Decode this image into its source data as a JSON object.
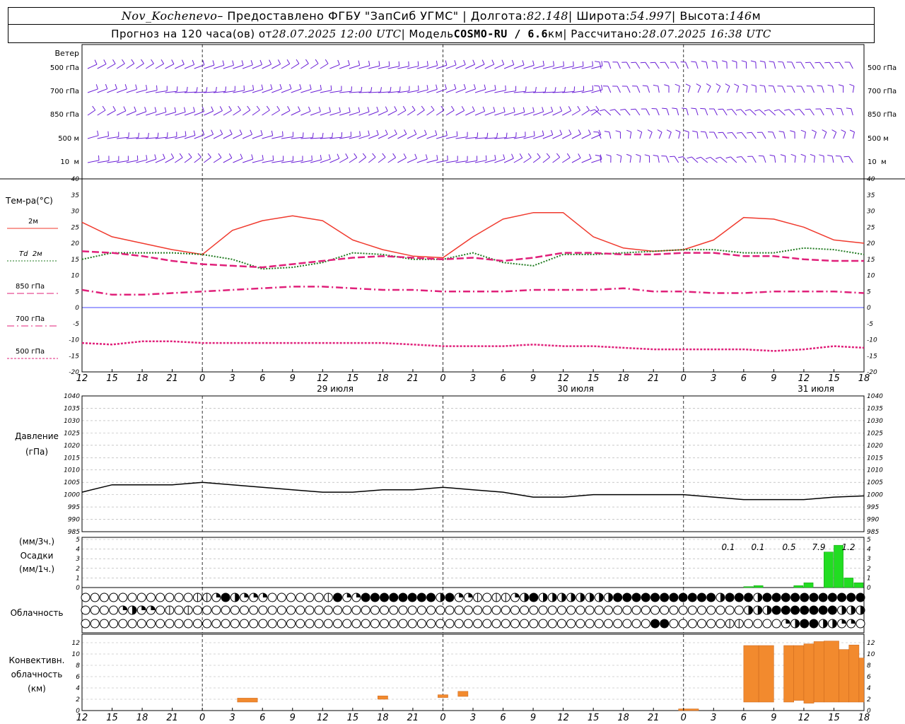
{
  "header": {
    "station": "Nov_Kochenevo",
    "provider": " – Предоставлено ФГБУ \"ЗапСиб УГМС\" | Долгота: ",
    "lon": "82.148",
    "lat_label": " | Широта: ",
    "lat": "54.997",
    "alt_label": " | Высота: ",
    "alt": "146",
    "alt_unit": "м",
    "forecast_label": "Прогноз на 120 часа(ов) от ",
    "forecast_start": "28.07.2025 12:00 UTC",
    "model_label": " | Модель ",
    "model": "COSMO-RU / 6.6",
    "model_unit": "км",
    "calc_label": " | Рассчитано: ",
    "calc_time": "28.07.2025 16:38 UTC"
  },
  "time_axis": {
    "hour_labels": [
      "12",
      "15",
      "18",
      "21",
      "0",
      "3",
      "6",
      "9",
      "12",
      "15",
      "18",
      "21",
      "0",
      "3",
      "6",
      "9",
      "12",
      "15",
      "18",
      "21",
      "0",
      "3",
      "6",
      "9",
      "12",
      "15",
      "18"
    ],
    "dates": [
      "29 июля",
      "30 июля",
      "31 июля"
    ]
  },
  "wind_panel": {
    "title": "Ветер",
    "levels": [
      "500 гПа",
      "700 гПа",
      "850 гПа",
      "500 м",
      "10  м"
    ],
    "barb_color": "#6a1fd6"
  },
  "temp_panel": {
    "title": "Тем-ра(°С)",
    "legend": [
      {
        "text": "2м",
        "color": "#f03a2e",
        "style": "solid"
      },
      {
        "text": "Td  2м",
        "color": "#1f7a1f",
        "style": "dotted"
      },
      {
        "text": "850 гПа",
        "color": "#e0207a",
        "style": "longdash"
      },
      {
        "text": "700 гПа",
        "color": "#e0207a",
        "style": "dashdot"
      },
      {
        "text": "500 гПа",
        "color": "#e0207a",
        "style": "shortdot"
      }
    ],
    "y_ticks": [
      "40",
      "35",
      "30",
      "25",
      "20",
      "15",
      "10",
      "5",
      "0",
      "-5",
      "-10",
      "-15",
      "-20"
    ]
  },
  "pressure_panel": {
    "title": "Давление",
    "unit": "(гПа)",
    "y_ticks": [
      "1040",
      "1035",
      "1030",
      "1025",
      "1020",
      "1015",
      "1010",
      "1005",
      "1000",
      "995",
      "990",
      "985"
    ]
  },
  "precip_panel": {
    "unit1": "(мм/3ч.)",
    "title": "Осадки",
    "unit2": "(мм/1ч.)",
    "y_ticks": [
      "5",
      "4",
      "3",
      "2",
      "1",
      "0"
    ],
    "totals": [
      "0.1",
      "0.1",
      "0.5",
      "7.9",
      "1.2"
    ]
  },
  "cloud_panel": {
    "title": "Облачность"
  },
  "conv_panel": {
    "title1": "Конвективн.",
    "title2": "облачность",
    "unit": "(км)",
    "y_ticks": [
      "12",
      "10",
      "8",
      "6",
      "4",
      "2",
      "0"
    ]
  },
  "chart_data": [
    {
      "type": "line",
      "title": "Тем-ра(°С)",
      "ylim": [
        -20,
        40
      ],
      "x_hours": [
        0,
        3,
        6,
        9,
        12,
        15,
        18,
        21,
        24,
        27,
        30,
        33,
        36,
        39,
        42,
        45,
        48,
        51,
        54,
        57,
        60,
        63,
        66,
        69,
        72,
        75,
        78
      ],
      "series": [
        {
          "name": "2м",
          "values": [
            26.5,
            22,
            20,
            18,
            16.5,
            24,
            27,
            28.5,
            27,
            21,
            18,
            16,
            15.5,
            22,
            27.5,
            29.5,
            29.5,
            22,
            18.5,
            17.5,
            18,
            21,
            28,
            27.5,
            25,
            21,
            20
          ]
        },
        {
          "name": "Td  2м",
          "values": [
            15,
            17,
            17,
            17,
            16.5,
            15,
            12,
            12.5,
            14,
            17,
            16.5,
            15,
            15,
            17,
            14,
            13,
            16.5,
            16.5,
            17,
            17.5,
            18,
            18,
            17,
            17,
            18.5,
            18,
            16.5
          ]
        },
        {
          "name": "850 гПа",
          "values": [
            17.5,
            17,
            16,
            14.5,
            13.5,
            13,
            12.5,
            13.5,
            14.5,
            15.5,
            16,
            15.5,
            15,
            15.5,
            14.5,
            15.5,
            17,
            17,
            16.5,
            16.5,
            17,
            17,
            16,
            16,
            15,
            14.5,
            14.5
          ]
        },
        {
          "name": "700 гПа",
          "values": [
            5.5,
            4,
            4,
            4.5,
            5,
            5.5,
            6,
            6.5,
            6.5,
            6,
            5.5,
            5.5,
            5,
            5,
            5,
            5.5,
            5.5,
            5.5,
            6,
            5,
            5,
            4.5,
            4.5,
            5,
            5,
            5,
            4.5
          ]
        },
        {
          "name": "500 гПа",
          "values": [
            -11,
            -11.5,
            -10.5,
            -10.5,
            -11,
            -11,
            -11,
            -11,
            -11,
            -11,
            -11,
            -11.5,
            -12,
            -12,
            -12,
            -11.5,
            -12,
            -12,
            -12.5,
            -13,
            -13,
            -13,
            -13,
            -13.5,
            -13,
            -12,
            -12.5
          ]
        }
      ]
    },
    {
      "type": "line",
      "title": "Давление",
      "ylim": [
        985,
        1040
      ],
      "x_hours": [
        0,
        3,
        6,
        9,
        12,
        15,
        18,
        21,
        24,
        27,
        30,
        33,
        36,
        39,
        42,
        45,
        48,
        51,
        54,
        57,
        60,
        63,
        66,
        69,
        72,
        75,
        78
      ],
      "series": [
        {
          "name": "",
          "values": [
            1001,
            1004,
            1004,
            1004,
            1005,
            1004,
            1003,
            1002,
            1001,
            1001,
            1002,
            1002,
            1003,
            1002,
            1001,
            999,
            999,
            1000,
            1000,
            1000,
            1000,
            999,
            998,
            998,
            998,
            999,
            999.5
          ]
        }
      ]
    },
    {
      "type": "bar",
      "title": "Осадки",
      "ylim": [
        0,
        5
      ],
      "x_hours": [
        66,
        67,
        68,
        69,
        70,
        71,
        72,
        73,
        74,
        75,
        76,
        77
      ],
      "values": [
        0.1,
        0.2,
        0,
        0,
        0,
        0.2,
        0.5,
        0,
        3.7,
        4.4,
        1,
        0.5
      ]
    },
    {
      "type": "bar",
      "title": "Конвективн. облачность",
      "ylim": [
        0,
        13
      ],
      "bars": [
        {
          "from": 15.5,
          "to": 17.5,
          "base": 1.5,
          "top": 2.2
        },
        {
          "from": 29.5,
          "to": 30.5,
          "base": 2,
          "top": 2.6
        },
        {
          "from": 35.5,
          "to": 36.5,
          "base": 2.3,
          "top": 2.8
        },
        {
          "from": 37.5,
          "to": 38.5,
          "base": 2.5,
          "top": 3.4
        },
        {
          "from": 59.5,
          "to": 61.5,
          "base": 0,
          "top": 0.3
        },
        {
          "from": 66,
          "to": 67.5,
          "base": 1.5,
          "top": 11.5
        },
        {
          "from": 67.5,
          "to": 69,
          "base": 1.5,
          "top": 11.5
        },
        {
          "from": 70,
          "to": 71,
          "base": 1.5,
          "top": 11.5
        },
        {
          "from": 71,
          "to": 72,
          "base": 1.8,
          "top": 11.5
        },
        {
          "from": 72,
          "to": 73,
          "base": 1.3,
          "top": 11.8
        },
        {
          "from": 73,
          "to": 74,
          "base": 1.5,
          "top": 12.2
        },
        {
          "from": 74,
          "to": 75.5,
          "base": 1.5,
          "top": 12.3
        },
        {
          "from": 75.5,
          "to": 76.5,
          "base": 1.5,
          "top": 10.8
        },
        {
          "from": 76.5,
          "to": 77.5,
          "base": 1.5,
          "top": 11.6
        },
        {
          "from": 77.5,
          "to": 78,
          "base": 1.5,
          "top": 9.3
        }
      ]
    }
  ],
  "cloud_rows": [
    "000000000000112432220000001422444444443422101123433333333444444444443444344444444444",
    "000023220101000000000000000000000000000000000000000000000000000000000003334444444333",
    "000000000000000000000000000000000000000000000000000000000000044000000110000234433220"
  ]
}
